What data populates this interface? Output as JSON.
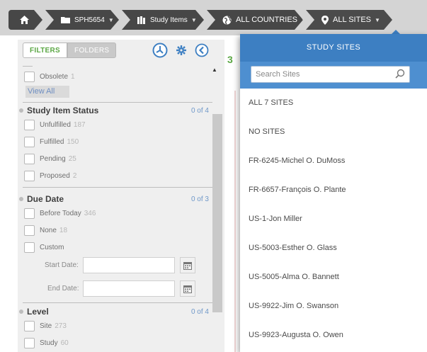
{
  "breadcrumb": {
    "home_icon": "home-icon",
    "study": {
      "label": "SPH5654",
      "icon": "folder-icon"
    },
    "study_items": {
      "label": "Study Items",
      "icon": "book-icon"
    },
    "countries": {
      "label": "ALL COUNTRIES",
      "icon": "globe-icon"
    },
    "sites": {
      "label": "ALL SITES",
      "icon": "map-pin-icon"
    }
  },
  "filters_panel": {
    "tabs": [
      {
        "label": "FILTERS",
        "active": true
      },
      {
        "label": "FOLDERS",
        "active": false
      }
    ],
    "icons": [
      "history-icon",
      "gear-icon",
      "collapse-left-icon"
    ],
    "top_option": {
      "label": "Obsolete",
      "count": "1"
    },
    "view_all": "View All",
    "sections": [
      {
        "title": "Study Item Status",
        "selected": "0 of 4",
        "options": [
          {
            "label": "Unfulfilled",
            "count": "187"
          },
          {
            "label": "Fulfilled",
            "count": "150"
          },
          {
            "label": "Pending",
            "count": "25"
          },
          {
            "label": "Proposed",
            "count": "2"
          }
        ]
      },
      {
        "title": "Due Date",
        "selected": "0 of 3",
        "options": [
          {
            "label": "Before Today",
            "count": "346"
          },
          {
            "label": "None",
            "count": "18"
          },
          {
            "label": "Custom",
            "count": ""
          }
        ],
        "start_date_label": "Start Date:",
        "end_date_label": "End Date:"
      },
      {
        "title": "Level",
        "selected": "0 of 4",
        "options": [
          {
            "label": "Site",
            "count": "273"
          },
          {
            "label": "Study",
            "count": "60"
          }
        ]
      }
    ]
  },
  "content_peek": {
    "number": "3"
  },
  "sites_dropdown": {
    "header": "STUDY SITES",
    "search_placeholder": "Search Sites",
    "items": [
      "ALL 7 SITES",
      "NO SITES",
      "FR-6245-Michel O. DuMoss",
      "FR-6657-François O. Plante",
      "US-1-Jon Miller",
      "US-5003-Esther O. Glass",
      "US-5005-Alma O. Bannett",
      "US-9922-Jim O. Swanson",
      "US-9923-Augusta O. Owen"
    ]
  },
  "colors": {
    "accent_blue": "#3d7fc2",
    "green": "#5ba744",
    "crumb_bg": "#474747"
  }
}
